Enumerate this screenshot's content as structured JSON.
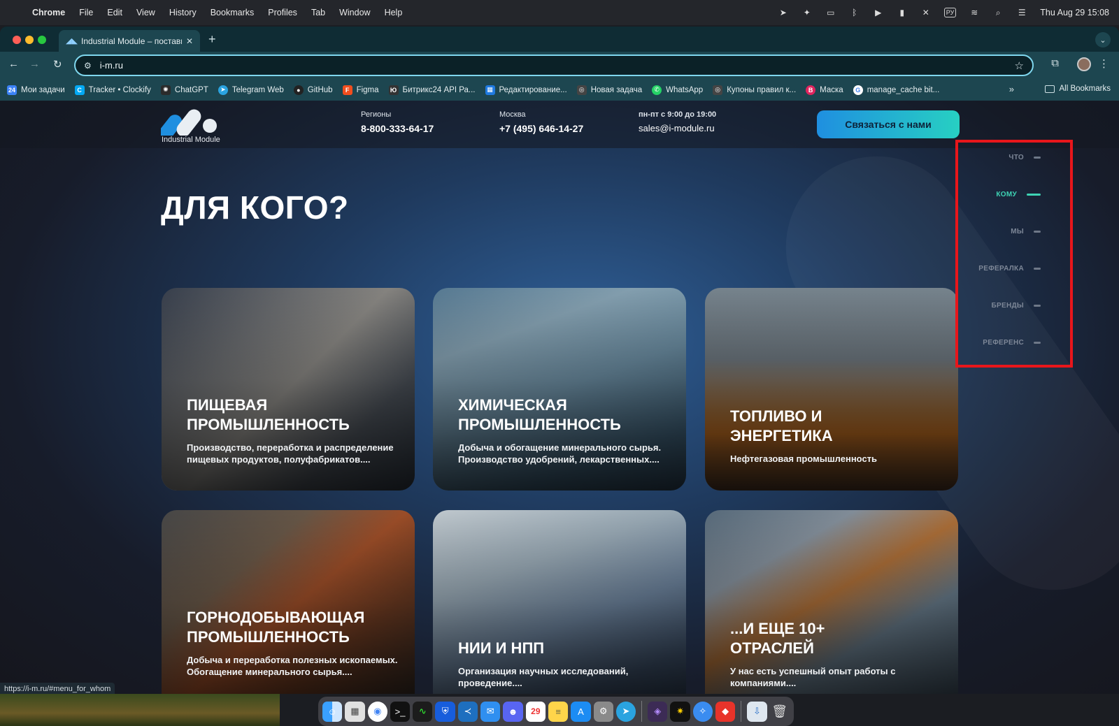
{
  "menubar": {
    "app": "Chrome",
    "items": [
      "File",
      "Edit",
      "View",
      "History",
      "Bookmarks",
      "Profiles",
      "Tab",
      "Window",
      "Help"
    ],
    "clock": "Thu Aug 29  15:08",
    "input_source": "РУ"
  },
  "browser": {
    "tab_title": "Industrial Module – поставщ...",
    "url": "i-m.ru",
    "bookmarks": [
      {
        "label": "Мои задачи",
        "color": "#3b82f6",
        "icon": "24"
      },
      {
        "label": "Tracker • Clockify",
        "color": "#03a9f4",
        "icon": "C"
      },
      {
        "label": "ChatGPT",
        "color": "#2b2b2b",
        "icon": "✺"
      },
      {
        "label": "Telegram Web",
        "color": "#2aa3e0",
        "icon": "➤"
      },
      {
        "label": "GitHub",
        "color": "#222",
        "icon": "●"
      },
      {
        "label": "Figma",
        "color": "#f24e1e",
        "icon": "F"
      },
      {
        "label": "Битрикс24 API Ра...",
        "color": "#333",
        "icon": "Ю"
      },
      {
        "label": "Редактирование...",
        "color": "#1f7ae0",
        "icon": "▦"
      },
      {
        "label": "Новая задача",
        "color": "#444",
        "icon": "◎"
      },
      {
        "label": "WhatsApp",
        "color": "#25d366",
        "icon": "✆"
      },
      {
        "label": "Купоны правил к...",
        "color": "#444",
        "icon": "◎"
      },
      {
        "label": "Маска",
        "color": "#e0245e",
        "icon": "B"
      },
      {
        "label": "manage_cache bit...",
        "color": "#fff",
        "icon": "G"
      }
    ],
    "all_bookmarks": "All Bookmarks",
    "status_url": "https://i-m.ru/#menu_for_whom"
  },
  "site": {
    "logo_text": "Industrial Module",
    "contacts": [
      {
        "label": "Регионы",
        "value": "8-800-333-64-17"
      },
      {
        "label": "Москва",
        "value": "+7 (495) 646-14-27"
      },
      {
        "label": "пн-пт с 9:00 до 19:00",
        "value": "sales@i-module.ru"
      }
    ],
    "cta": "Связаться с нами",
    "headline": "ДЛЯ КОГО?",
    "cards": [
      {
        "title": "Пищевая промышленность",
        "desc": "Производство, переработка и распределение пищевых продуктов, полуфабрикатов...."
      },
      {
        "title": "Химическая промышленность",
        "desc": "Добыча и обогащение минерального сырья. Производство удобрений, лекарственных...."
      },
      {
        "title": "Топливо и энергетика",
        "desc": "Нефтегазовая промышленность"
      },
      {
        "title": "Горнодобывающая промышленность",
        "desc": "Добыча и переработка полезных ископаемых. Обогащение минерального сырья...."
      },
      {
        "title": "НИИ и НПП",
        "desc": "Организация научных исследований, проведение...."
      },
      {
        "title": "...и еще 10+ отраслей",
        "desc": "У нас есть успешный опыт работы с компаниями...."
      }
    ],
    "sidenav": [
      {
        "label": "ЧТО",
        "active": false
      },
      {
        "label": "КОМУ",
        "active": true
      },
      {
        "label": "МЫ",
        "active": false
      },
      {
        "label": "РЕФЕРАЛКА",
        "active": false
      },
      {
        "label": "БРЕНДЫ",
        "active": false
      },
      {
        "label": "РЕФЕРЕНС",
        "active": false
      }
    ]
  },
  "colors": {
    "accent": "#3ed3b4",
    "cta_start": "#1f8fe0",
    "cta_end": "#27d0c2",
    "highlight": "#e8161b"
  }
}
